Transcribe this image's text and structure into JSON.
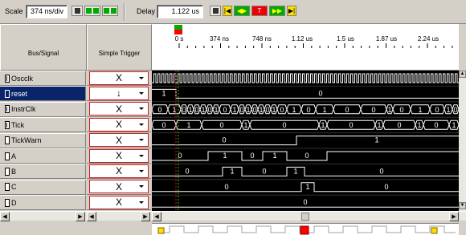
{
  "toolbar": {
    "scale_label": "Scale",
    "scale_value": "374 ns/div",
    "delay_label": "Delay",
    "delay_value": "1.122 us"
  },
  "headers": {
    "bus_signal": "Bus/Signal",
    "simple_trigger": "Simple Trigger"
  },
  "ruler": {
    "ticks": [
      "0 s",
      "374 ns",
      "748 ns",
      "1.12 us",
      "1.5 us",
      "1.87 us",
      "2.24 us"
    ]
  },
  "signals": [
    {
      "name": "Oscclk",
      "type": "bus",
      "trigger": "X",
      "selected": false
    },
    {
      "name": "reset",
      "type": "signal",
      "trigger": "↓",
      "selected": true
    },
    {
      "name": "InstrClk",
      "type": "bus",
      "trigger": "X",
      "selected": false
    },
    {
      "name": "Tick",
      "type": "bus",
      "trigger": "X",
      "selected": false
    },
    {
      "name": "TickWarn",
      "type": "signal",
      "trigger": "X",
      "selected": false
    },
    {
      "name": "A",
      "type": "signal",
      "trigger": "X",
      "selected": false
    },
    {
      "name": "B",
      "type": "signal",
      "trigger": "X",
      "selected": false
    },
    {
      "name": "C",
      "type": "signal",
      "trigger": "X",
      "selected": false
    },
    {
      "name": "D",
      "type": "signal",
      "trigger": "X",
      "selected": false
    }
  ],
  "waveform_values": {
    "reset": [
      "1",
      "0"
    ],
    "instrclk": [
      "0",
      "1",
      "0",
      "1",
      "0",
      "1",
      "0",
      "1",
      "0",
      "1",
      "0",
      "1",
      "0",
      "1",
      "0",
      "1",
      "0",
      "1",
      "0",
      "1",
      "0"
    ],
    "tick": [
      "0",
      "1",
      "0",
      "1",
      "0",
      "1",
      "0",
      "1",
      "0",
      "1"
    ],
    "tickwarn": [
      "0",
      "1"
    ],
    "a": [
      "0",
      "1",
      "0",
      "1",
      "0"
    ],
    "b": [
      "0",
      "1",
      "0",
      "1",
      "0"
    ],
    "c": [
      "0",
      "1",
      "0"
    ],
    "d": [
      "0"
    ]
  },
  "colors": {
    "waveform": "#ffffff",
    "background": "#000000",
    "cursor_red": "#ff0000",
    "cursor_green": "#00cc00",
    "selected_row": "#0a246a",
    "trigger_border": "#cc2020"
  }
}
